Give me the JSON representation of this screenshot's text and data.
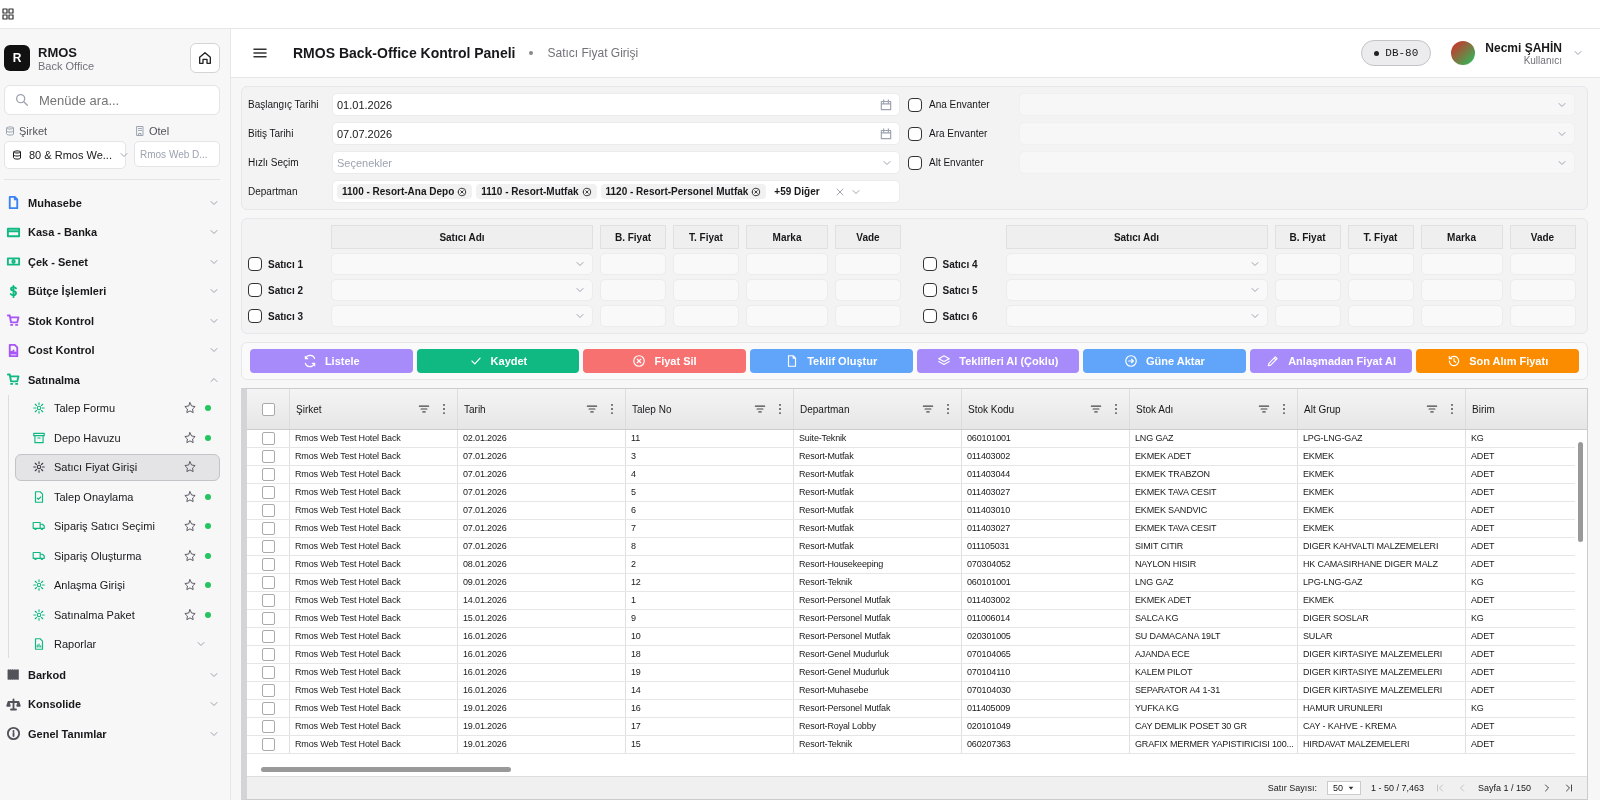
{
  "sidebar": {
    "brand": {
      "logo": "R",
      "name": "RMOS",
      "subtitle": "Back Office"
    },
    "search": {
      "placeholder": "Menüde ara..."
    },
    "company": {
      "label": "Şirket",
      "value": "80 & Rmos We..."
    },
    "hotel": {
      "label": "Otel",
      "placeholder": "Rmos Web D..."
    },
    "menu": [
      {
        "label": "Muhasebe",
        "color": "#3b82f6",
        "expanded": false
      },
      {
        "label": "Kasa - Banka",
        "color": "#10b981",
        "expanded": false
      },
      {
        "label": "Çek - Senet",
        "color": "#10b981",
        "expanded": false
      },
      {
        "label": "Bütçe İşlemleri",
        "color": "#10b981",
        "expanded": false
      },
      {
        "label": "Stok Kontrol",
        "color": "#a855f7",
        "expanded": false
      },
      {
        "label": "Cost Kontrol",
        "color": "#a855f7",
        "expanded": false
      },
      {
        "label": "Satınalma",
        "color": "#10b981",
        "expanded": true,
        "children": [
          {
            "kind": "page",
            "label": "Talep Formu",
            "selected": false,
            "starred": false,
            "active": true
          },
          {
            "kind": "page",
            "label": "Depo Havuzu",
            "selected": false,
            "starred": false,
            "active": true
          },
          {
            "kind": "page",
            "label": "Satıcı Fiyat Girişi",
            "selected": true,
            "starred": false,
            "active": false
          },
          {
            "kind": "page",
            "label": "Talep Onaylama",
            "selected": false,
            "starred": false,
            "active": true
          },
          {
            "kind": "page",
            "label": "Sipariş Satıcı Seçimi",
            "selected": false,
            "starred": false,
            "active": true
          },
          {
            "kind": "page",
            "label": "Sipariş Oluşturma",
            "selected": false,
            "starred": false,
            "active": true
          },
          {
            "kind": "page",
            "label": "Anlaşma Girişi",
            "selected": false,
            "starred": false,
            "active": true
          },
          {
            "kind": "page",
            "label": "Satınalma Paket",
            "selected": false,
            "starred": false,
            "active": true
          },
          {
            "kind": "group",
            "label": "Raporlar",
            "expanded": false
          }
        ]
      },
      {
        "label": "Barkod",
        "color": "#52525b",
        "expanded": false
      },
      {
        "label": "Konsolide",
        "color": "#52525b",
        "expanded": false
      },
      {
        "label": "Genel Tanımlar",
        "color": "#52525b",
        "expanded": false
      }
    ]
  },
  "header": {
    "title": "RMOS Back-Office Kontrol Paneli",
    "page": "Satıcı Fiyat Girişi",
    "db": "DB-80",
    "user": {
      "name": "Necmi ŞAHİN",
      "role": "Kullanıcı"
    }
  },
  "filters": {
    "fields": [
      {
        "kind": "date",
        "label": "Başlangıç Tarihi",
        "value": "01.01.2026"
      },
      {
        "kind": "date",
        "label": "Bitiş Tarihi",
        "value": "07.07.2026"
      },
      {
        "kind": "select",
        "label": "Hızlı Seçim",
        "placeholder": "Seçenekler"
      },
      {
        "kind": "tags",
        "label": "Departman",
        "tags": [
          "1100 - Resort-Ana Depo",
          "1110 - Resort-Mutfak",
          "1120 - Resort-Personel Mutfak"
        ],
        "more": "+59 Diğer"
      }
    ],
    "inventories": [
      {
        "label": "Ana Envanter",
        "checked": false
      },
      {
        "label": "Ara Envanter",
        "checked": false
      },
      {
        "label": "Alt Envanter",
        "checked": false
      }
    ]
  },
  "sellers": [
    {
      "columns": [
        "Satıcı Adı",
        "B. Fiyat",
        "T. Fiyat",
        "Marka",
        "Vade"
      ],
      "rows": [
        {
          "label": "Satıcı 1",
          "checked": false
        },
        {
          "label": "Satıcı 2",
          "checked": false
        },
        {
          "label": "Satıcı 3",
          "checked": false
        }
      ]
    },
    {
      "columns": [
        "Satıcı Adı",
        "B. Fiyat",
        "T. Fiyat",
        "Marka",
        "Vade"
      ],
      "rows": [
        {
          "label": "Satıcı 4",
          "checked": false
        },
        {
          "label": "Satıcı 5",
          "checked": false
        },
        {
          "label": "Satıcı 6",
          "checked": false
        }
      ]
    }
  ],
  "actions": [
    {
      "label": "Listele",
      "color": "#a78bfa"
    },
    {
      "label": "Kaydet",
      "color": "#10b981"
    },
    {
      "label": "Fiyat Sil",
      "color": "#f87171"
    },
    {
      "label": "Teklif Oluştur",
      "color": "#60a5fa"
    },
    {
      "label": "Teklifleri Al (Çoklu)",
      "color": "#a78bfa"
    },
    {
      "label": "Güne Aktar",
      "color": "#60a5fa"
    },
    {
      "label": "Anlaşmadan Fiyat Al",
      "color": "#a78bfa"
    },
    {
      "label": "Son Alım Fiyatı",
      "color": "#fb8c00"
    }
  ],
  "table": {
    "all_checked": false,
    "columns": [
      "Şirket",
      "Tarih",
      "Talep No",
      "Departman",
      "Stok Kodu",
      "Stok Adı",
      "Alt Grup",
      "Birim"
    ],
    "rows": [
      {
        "checked": false,
        "cells": [
          "Rmos Web Test Hotel Back",
          "02.01.2026",
          "11",
          "Suite-Teknik",
          "060101001",
          "LNG GAZ",
          "LPG-LNG-GAZ",
          "KG"
        ]
      },
      {
        "checked": false,
        "cells": [
          "Rmos Web Test Hotel Back",
          "07.01.2026",
          "3",
          "Resort-Mutfak",
          "011403002",
          "EKMEK ADET",
          "EKMEK",
          "ADET"
        ]
      },
      {
        "checked": false,
        "cells": [
          "Rmos Web Test Hotel Back",
          "07.01.2026",
          "4",
          "Resort-Mutfak",
          "011403044",
          "EKMEK TRABZON",
          "EKMEK",
          "ADET"
        ]
      },
      {
        "checked": false,
        "cells": [
          "Rmos Web Test Hotel Back",
          "07.01.2026",
          "5",
          "Resort-Mutfak",
          "011403027",
          "EKMEK TAVA CESIT",
          "EKMEK",
          "ADET"
        ]
      },
      {
        "checked": false,
        "cells": [
          "Rmos Web Test Hotel Back",
          "07.01.2026",
          "6",
          "Resort-Mutfak",
          "011403010",
          "EKMEK SANDVIC",
          "EKMEK",
          "ADET"
        ]
      },
      {
        "checked": false,
        "cells": [
          "Rmos Web Test Hotel Back",
          "07.01.2026",
          "7",
          "Resort-Mutfak",
          "011403027",
          "EKMEK TAVA CESIT",
          "EKMEK",
          "ADET"
        ]
      },
      {
        "checked": false,
        "cells": [
          "Rmos Web Test Hotel Back",
          "07.01.2026",
          "8",
          "Resort-Mutfak",
          "011105031",
          "SIMIT CITIR",
          "DIGER KAHVALTI MALZEMELERI",
          "ADET"
        ]
      },
      {
        "checked": false,
        "cells": [
          "Rmos Web Test Hotel Back",
          "08.01.2026",
          "2",
          "Resort-Housekeeping",
          "070304052",
          "NAYLON HISIR",
          "HK CAMASIRHANE DIGER MALZ",
          "ADET"
        ]
      },
      {
        "checked": false,
        "cells": [
          "Rmos Web Test Hotel Back",
          "09.01.2026",
          "12",
          "Resort-Teknik",
          "060101001",
          "LNG GAZ",
          "LPG-LNG-GAZ",
          "KG"
        ]
      },
      {
        "checked": false,
        "cells": [
          "Rmos Web Test Hotel Back",
          "14.01.2026",
          "1",
          "Resort-Personel Mutfak",
          "011403002",
          "EKMEK ADET",
          "EKMEK",
          "ADET"
        ]
      },
      {
        "checked": false,
        "cells": [
          "Rmos Web Test Hotel Back",
          "15.01.2026",
          "9",
          "Resort-Personel Mutfak",
          "011006014",
          "SALCA KG",
          "DIGER SOSLAR",
          "KG"
        ]
      },
      {
        "checked": false,
        "cells": [
          "Rmos Web Test Hotel Back",
          "16.01.2026",
          "10",
          "Resort-Personel Mutfak",
          "020301005",
          "SU DAMACANA 19LT",
          "SULAR",
          "ADET"
        ]
      },
      {
        "checked": false,
        "cells": [
          "Rmos Web Test Hotel Back",
          "16.01.2026",
          "18",
          "Resort-Genel Mudurluk",
          "070104065",
          "AJANDA ECE",
          "DIGER KIRTASIYE MALZEMELERI",
          "ADET"
        ]
      },
      {
        "checked": false,
        "cells": [
          "Rmos Web Test Hotel Back",
          "16.01.2026",
          "19",
          "Resort-Genel Mudurluk",
          "070104110",
          "KALEM PILOT",
          "DIGER KIRTASIYE MALZEMELERI",
          "ADET"
        ]
      },
      {
        "checked": false,
        "cells": [
          "Rmos Web Test Hotel Back",
          "16.01.2026",
          "14",
          "Resort-Muhasebe",
          "070104030",
          "SEPARATOR A4 1-31",
          "DIGER KIRTASIYE MALZEMELERI",
          "ADET"
        ]
      },
      {
        "checked": false,
        "cells": [
          "Rmos Web Test Hotel Back",
          "19.01.2026",
          "16",
          "Resort-Personel Mutfak",
          "011405009",
          "YUFKA KG",
          "HAMUR URUNLERI",
          "KG"
        ]
      },
      {
        "checked": false,
        "cells": [
          "Rmos Web Test Hotel Back",
          "19.01.2026",
          "17",
          "Resort-Royal Lobby",
          "020101049",
          "CAY DEMLIK POSET 30 GR",
          "CAY - KAHVE - KREMA",
          "ADET"
        ]
      },
      {
        "checked": false,
        "cells": [
          "Rmos Web Test Hotel Back",
          "19.01.2026",
          "15",
          "Resort-Teknik",
          "060207363",
          "GRAFIX MERMER YAPISTIRICISI 100...",
          "HIRDAVAT MALZEMELERI",
          "ADET"
        ]
      }
    ]
  },
  "pager": {
    "rows_label": "Satır Sayısı:",
    "page_size": "50",
    "range": "1 - 50 / 7,463",
    "page": "Sayfa 1 / 150"
  }
}
